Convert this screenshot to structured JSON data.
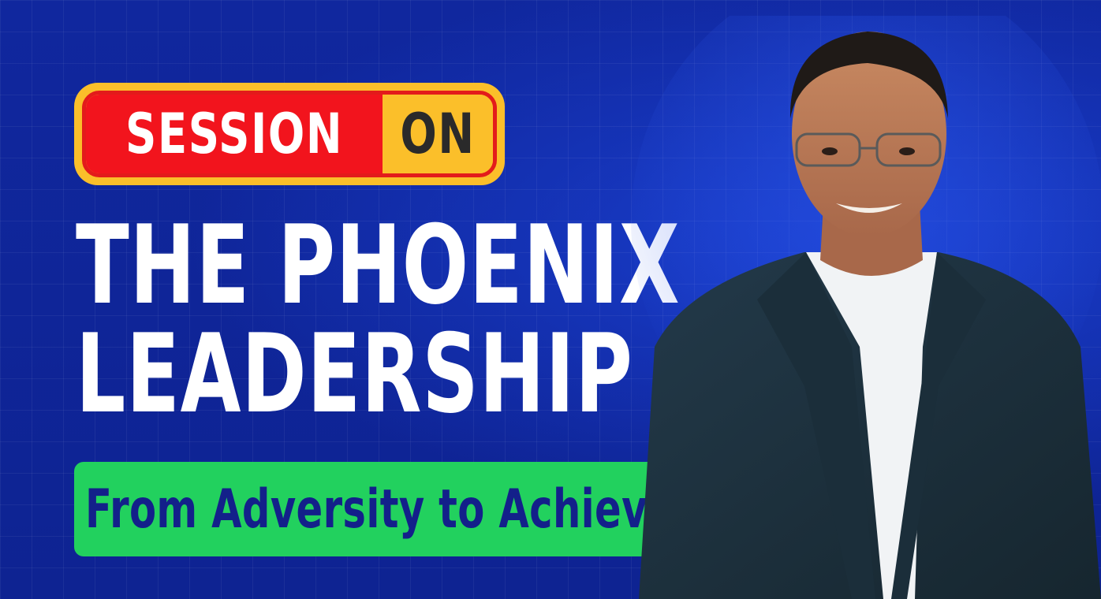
{
  "badge": {
    "word_left": "SESSION",
    "word_right": "ON"
  },
  "headline": {
    "line1": "THE PHOENIX",
    "line2": "LEADERSHIP"
  },
  "subtitle": "From Adversity to Achievement",
  "colors": {
    "background": "#10279e",
    "badge_red": "#f2141d",
    "badge_yellow": "#fbbf2a",
    "subtitle_green": "#22d15e",
    "subtitle_text": "#13208a",
    "headline_text": "#ffffff"
  },
  "speaker": {
    "image": "speaker-portrait"
  }
}
